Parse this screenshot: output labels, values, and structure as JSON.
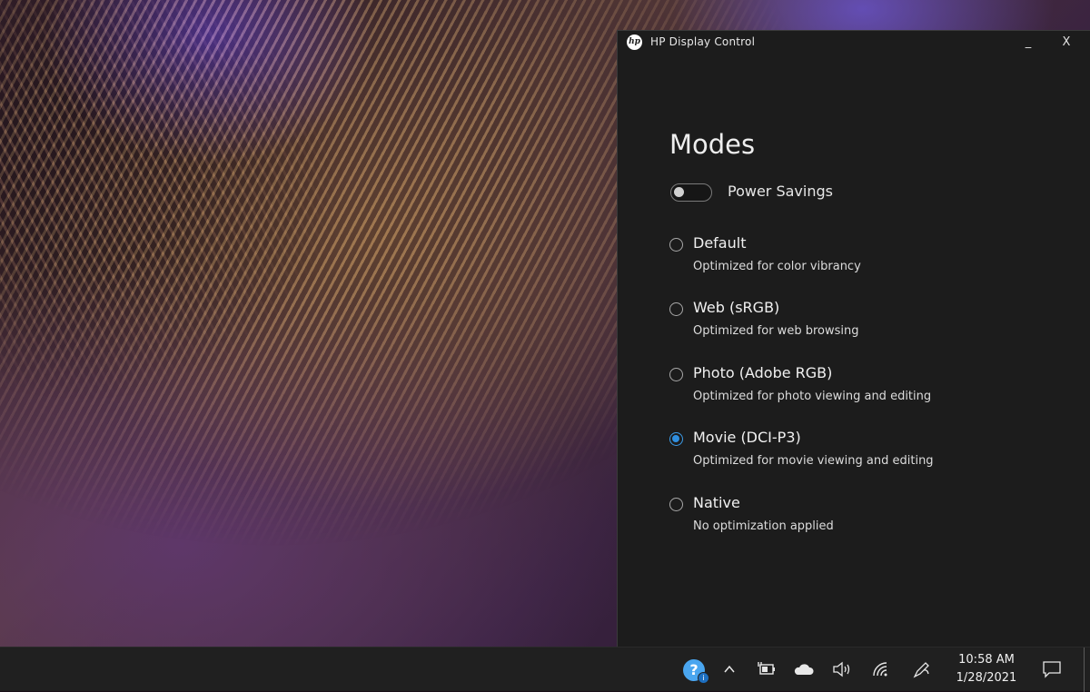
{
  "window": {
    "title": "HP Display Control",
    "logo_text": "hp",
    "minimize_label": "_",
    "close_label": "X"
  },
  "main": {
    "heading": "Modes",
    "power_savings": {
      "label": "Power Savings",
      "enabled": false
    },
    "modes": [
      {
        "title": "Default",
        "description": "Optimized for color vibrancy",
        "selected": false
      },
      {
        "title": "Web (sRGB)",
        "description": "Optimized for web browsing",
        "selected": false
      },
      {
        "title": "Photo (Adobe RGB)",
        "description": "Optimized for photo viewing and editing",
        "selected": false
      },
      {
        "title": "Movie (DCI-P3)",
        "description": "Optimized for movie viewing and editing",
        "selected": true
      },
      {
        "title": "Native",
        "description": "No optimization applied",
        "selected": false
      }
    ]
  },
  "taskbar": {
    "time": "10:58 AM",
    "date": "1/28/2021",
    "tray_icons": [
      "help-icon",
      "chevron-up-icon",
      "battery-charging-icon",
      "cloud-icon",
      "volume-icon",
      "wifi-icon",
      "pen-icon",
      "notifications-icon"
    ]
  },
  "colors": {
    "accent": "#2f8fe0",
    "window_bg": "#1c1c1c",
    "taskbar_bg": "#202020"
  }
}
